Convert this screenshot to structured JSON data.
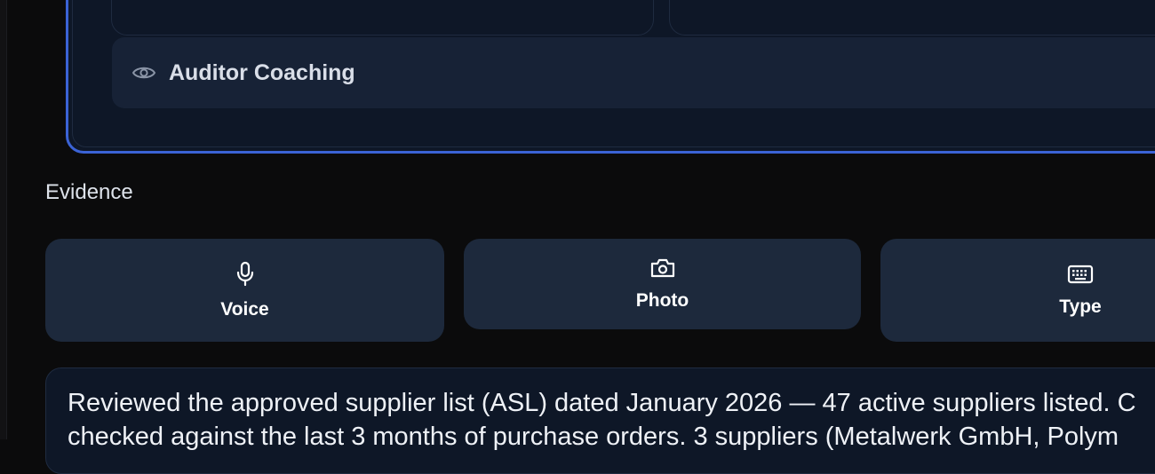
{
  "coaching": {
    "auditor_label": "Auditor Coaching",
    "icon": "eye-icon"
  },
  "evidence": {
    "section_title": "Evidence",
    "buttons": [
      {
        "label": "Voice",
        "icon": "microphone-icon"
      },
      {
        "label": "Photo",
        "icon": "camera-icon"
      },
      {
        "label": "Type",
        "icon": "keyboard-icon"
      }
    ],
    "notes_line1": "Reviewed the approved supplier list (ASL) dated January 2026 — 47 active suppliers listed. C",
    "notes_line2": "checked against the last 3 months of purchase orders. 3 suppliers (Metalwerk GmbH, Polym"
  },
  "colors": {
    "accent_border": "#3b63d6",
    "panel_bg": "#0e1727",
    "button_bg": "#1d293c"
  }
}
